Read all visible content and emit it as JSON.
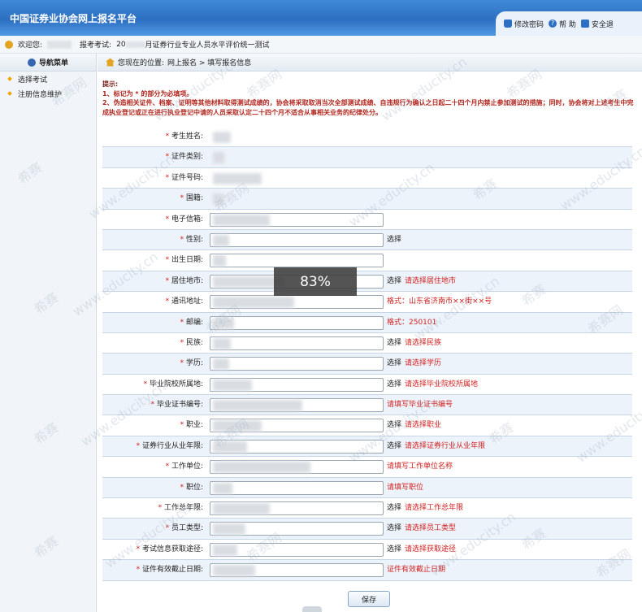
{
  "header": {
    "title": "中国证券业协会网上报名平台",
    "links": [
      {
        "label": "修改密码",
        "icon": "lock-icon"
      },
      {
        "label": "帮 助",
        "icon": "help-icon"
      },
      {
        "label": "安全退",
        "icon": "exit-icon"
      }
    ]
  },
  "userbar": {
    "welcome": "欢迎您:",
    "exam_label": "报考考试:",
    "exam_prefix": "20",
    "exam_suffix": "月证券行业专业人员水平评价统一测试"
  },
  "sidebar": {
    "title": "导航菜单",
    "items": [
      {
        "label": "选择考试"
      },
      {
        "label": "注册信息维护"
      }
    ]
  },
  "breadcrumb": {
    "prefix": "您现在的位置:",
    "path": "网上报名 > 填写报名信息"
  },
  "notice": {
    "title": "提示:",
    "line1": "1、标记为 * 的部分为必填项。",
    "line2": "2、伪造相关证件、档案、证明等其他材料取得测试成绩的，协会将采取取消当次全部测试成绩、自违规行为确认之日起二十四个月内禁止参加测试的措施；同时，协会将对上述考生中完成执业登记或正在进行执业登记中请的人员采取认定二十四个月不适合从事相关业务的纪律处分。"
  },
  "form_rows": [
    {
      "label": "考生姓名:",
      "input": false,
      "sel": "",
      "hint": ""
    },
    {
      "label": "证件类别:",
      "input": false,
      "sel": "",
      "hint": ""
    },
    {
      "label": "证件号码:",
      "input": false,
      "sel": "",
      "hint": ""
    },
    {
      "label": "国籍:",
      "input": false,
      "sel": "",
      "hint": ""
    },
    {
      "label": "电子信箱:",
      "input": true,
      "sel": "",
      "hint": ""
    },
    {
      "label": "性别:",
      "input": true,
      "sel": "选择",
      "hint": ""
    },
    {
      "label": "出生日期:",
      "input": true,
      "sel": "",
      "hint": ""
    },
    {
      "label": "居住地市:",
      "input": true,
      "sel": "选择",
      "hint": "请选择居住地市"
    },
    {
      "label": "通讯地址:",
      "input": true,
      "sel": "",
      "hint": "格式：山东省济南市××街××号"
    },
    {
      "label": "邮编:",
      "input": true,
      "sel": "",
      "hint": "格式：250101"
    },
    {
      "label": "民族:",
      "input": true,
      "sel": "选择",
      "hint": "请选择民族"
    },
    {
      "label": "学历:",
      "input": true,
      "sel": "选择",
      "hint": "请选择学历"
    },
    {
      "label": "毕业院校所属地:",
      "input": true,
      "sel": "选择",
      "hint": "请选择毕业院校所属地"
    },
    {
      "label": "毕业证书编号:",
      "input": true,
      "sel": "",
      "hint": "请填写毕业证书编号"
    },
    {
      "label": "职业:",
      "input": true,
      "sel": "选择",
      "hint": "请选择职业"
    },
    {
      "label": "证券行业从业年限:",
      "input": true,
      "sel": "选择",
      "hint": "请选择证券行业从业年限"
    },
    {
      "label": "工作单位:",
      "input": true,
      "sel": "",
      "hint": "请填写工作单位名称"
    },
    {
      "label": "职位:",
      "input": true,
      "sel": "",
      "hint": "请填写职位"
    },
    {
      "label": "工作总年限:",
      "input": true,
      "sel": "选择",
      "hint": "请选择工作总年限"
    },
    {
      "label": "员工类型:",
      "input": true,
      "sel": "选择",
      "hint": "请选择员工类型"
    },
    {
      "label": "考试信息获取途径:",
      "input": true,
      "sel": "选择",
      "hint": "请选择获取途径"
    },
    {
      "label": "证件有效截止日期:",
      "input": true,
      "sel": "",
      "hint": "证件有效截止日期"
    }
  ],
  "save_label": "保存",
  "progress_label": "83%",
  "watermarks": [
    "希赛网",
    "www.educity.cn",
    "希赛"
  ]
}
